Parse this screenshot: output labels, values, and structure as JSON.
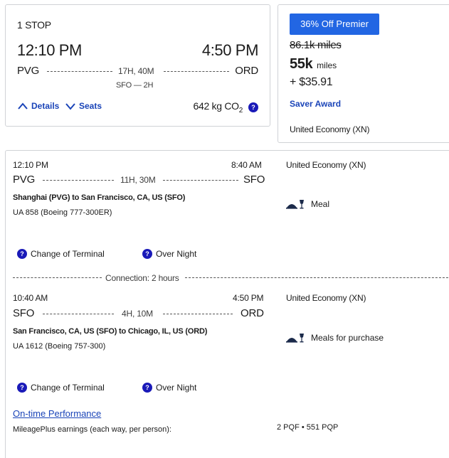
{
  "summary": {
    "stops": "1 STOP",
    "depart_time": "12:10 PM",
    "arrive_time": "4:50 PM",
    "origin": "PVG",
    "destination": "ORD",
    "duration": "17H, 40M",
    "layover": "SFO — 2H",
    "details_label": "Details",
    "seats_label": "Seats",
    "co2_value": "642 kg CO",
    "co2_sub": "2"
  },
  "fare": {
    "discount_badge": "36% Off Premier",
    "original_miles": "86.1k miles",
    "miles_value": "55k",
    "miles_unit": "miles",
    "cash": "+ $35.91",
    "award_type": "Saver Award",
    "cabin": "United Economy (XN)"
  },
  "segments": [
    {
      "depart_time": "12:10 PM",
      "arrive_time": "8:40 AM",
      "origin": "PVG",
      "destination": "SFO",
      "duration": "11H, 30M",
      "route": "Shanghai (PVG) to San Francisco, CA, US (SFO)",
      "flight": "UA 858 (Boeing 777-300ER)",
      "cabin": "United Economy (XN)",
      "meal": "Meal",
      "notice_terminal": "Change of Terminal",
      "notice_overnight": "Over Night"
    },
    {
      "depart_time": "10:40 AM",
      "arrive_time": "4:50 PM",
      "origin": "SFO",
      "destination": "ORD",
      "duration": "4H, 10M",
      "route": "San Francisco, CA, US (SFO) to Chicago, IL, US (ORD)",
      "flight": "UA 1612 (Boeing 757-300)",
      "cabin": "United Economy (XN)",
      "meal": "Meals for purchase",
      "notice_terminal": "Change of Terminal",
      "notice_overnight": "Over Night"
    }
  ],
  "connection": "Connection: 2 hours",
  "footer": {
    "ontime_link": "On-time Performance",
    "earnings_label": "MileagePlus earnings (each way, per person):",
    "earnings_value": "2 PQF • 551 PQP"
  },
  "icons": {
    "question": "?",
    "chevron_up": "chevron-up-icon",
    "chevron_down": "chevron-down-icon",
    "meal": "meal-icon"
  },
  "colors": {
    "accent": "#2266e3",
    "link": "#1a44b8",
    "info_icon": "#1a1ab8"
  }
}
